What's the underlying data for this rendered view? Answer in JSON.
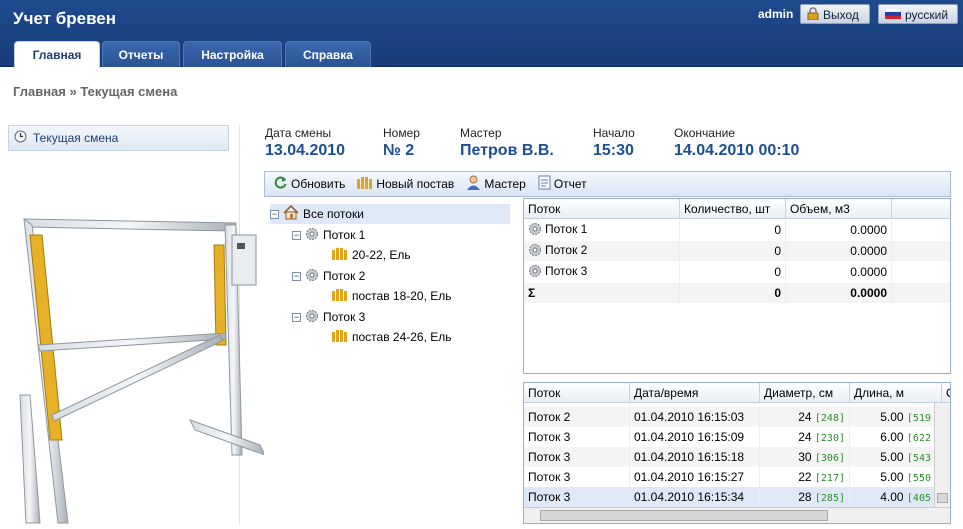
{
  "app_title": "Учет бревен",
  "user": "admin",
  "logout_label": "Выход",
  "lang_label": "русский",
  "tabs": [
    {
      "label": "Главная"
    },
    {
      "label": "Отчеты"
    },
    {
      "label": "Настройка"
    },
    {
      "label": "Справка"
    }
  ],
  "breadcrumb": "Главная » Текущая смена",
  "left_panel_item": "Текущая смена",
  "info": [
    {
      "label": "Дата смены",
      "value": "13.04.2010"
    },
    {
      "label": "Номер",
      "value": "№ 2"
    },
    {
      "label": "Мастер",
      "value": "Петров В.В."
    },
    {
      "label": "Начало",
      "value": "15:30"
    },
    {
      "label": "Окончание",
      "value": "14.04.2010 00:10"
    }
  ],
  "toolbar": {
    "refresh": "Обновить",
    "new_setup": "Новый постав",
    "master": "Мастер",
    "report": "Отчет"
  },
  "tree": {
    "root": "Все потоки",
    "streams": [
      {
        "label": "Поток 1",
        "child": "20-22, Ель"
      },
      {
        "label": "Поток 2",
        "child": "постав 18-20, Ель"
      },
      {
        "label": "Поток 3",
        "child": "постав 24-26, Ель"
      }
    ]
  },
  "summary_grid": {
    "headers": [
      "Поток",
      "Количество, шт",
      "Объем, м3"
    ],
    "rows": [
      {
        "stream": "Поток 1",
        "count": "0",
        "volume": "0.0000"
      },
      {
        "stream": "Поток 2",
        "count": "0",
        "volume": "0.0000"
      },
      {
        "stream": "Поток 3",
        "count": "0",
        "volume": "0.0000"
      }
    ],
    "total": {
      "symbol": "Σ",
      "count": "0",
      "volume": "0.0000"
    }
  },
  "log_grid": {
    "headers": [
      "Поток",
      "Дата/время",
      "Диаметр, см",
      "Длина, м",
      "С"
    ],
    "rows": [
      {
        "stream": "Поток 2",
        "datetime": "01.04.2010 16:15:03",
        "diameter": "24",
        "diameter_raw": "[248]",
        "length": "5.00",
        "length_raw": "[519"
      },
      {
        "stream": "Поток 3",
        "datetime": "01.04.2010 16:15:09",
        "diameter": "24",
        "diameter_raw": "[230]",
        "length": "6.00",
        "length_raw": "[622"
      },
      {
        "stream": "Поток 3",
        "datetime": "01.04.2010 16:15:18",
        "diameter": "30",
        "diameter_raw": "[306]",
        "length": "5.00",
        "length_raw": "[543"
      },
      {
        "stream": "Поток 3",
        "datetime": "01.04.2010 16:15:27",
        "diameter": "22",
        "diameter_raw": "[217]",
        "length": "5.00",
        "length_raw": "[550"
      },
      {
        "stream": "Поток 3",
        "datetime": "01.04.2010 16:15:34",
        "diameter": "28",
        "diameter_raw": "[285]",
        "length": "4.00",
        "length_raw": "[405"
      }
    ]
  }
}
